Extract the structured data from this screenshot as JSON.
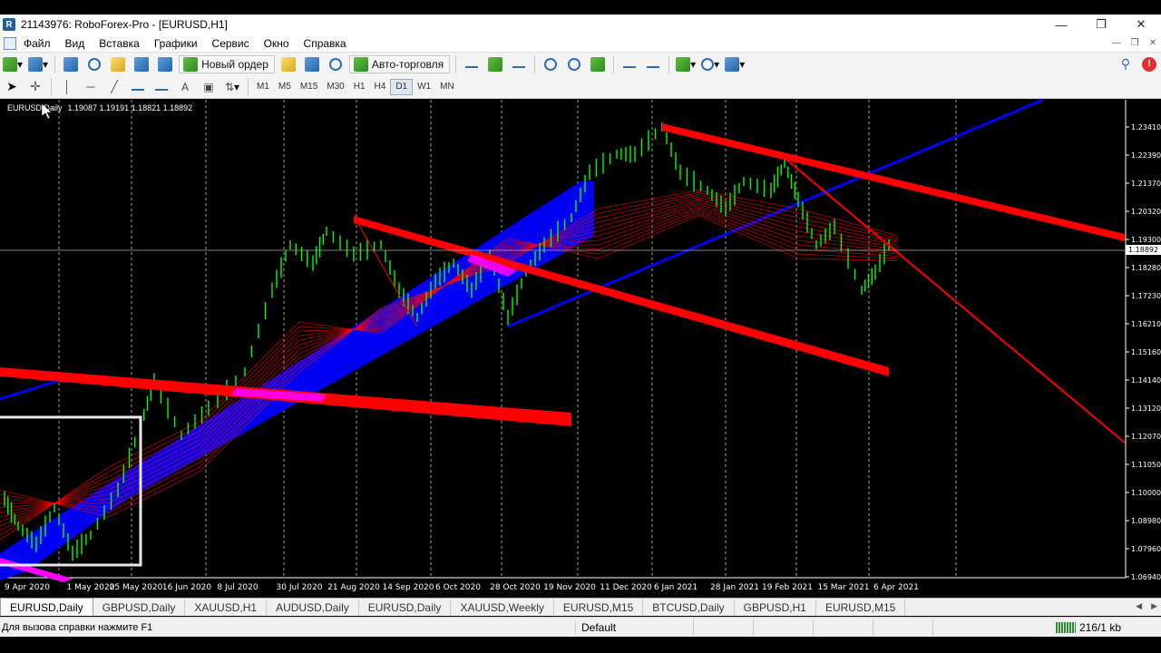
{
  "window": {
    "title": "21143976: RoboForex-Pro - [EURUSD,H1]",
    "app_icon_letter": "R"
  },
  "menu": [
    "Файл",
    "Вид",
    "Вставка",
    "Графики",
    "Сервис",
    "Окно",
    "Справка"
  ],
  "toolbar": {
    "new_order_label": "Новый ордер",
    "auto_trading_label": "Авто-торговля",
    "timeframes": [
      "M1",
      "M5",
      "M15",
      "M30",
      "H1",
      "H4",
      "D1",
      "W1",
      "MN"
    ],
    "active_timeframe": "D1"
  },
  "chart": {
    "symbol_label": "EURUSD,Daily",
    "ohlc": "1.19087 1.19191 1.18821 1.18892",
    "current_price": "1.18892",
    "price_labels": [
      "1.23410",
      "1.22390",
      "1.21370",
      "1.20320",
      "1.19300",
      "1.18280",
      "1.17230",
      "1.16210",
      "1.15160",
      "1.14140",
      "1.13120",
      "1.12070",
      "1.11050",
      "1.10000",
      "1.08980",
      "1.07960",
      "1.06940"
    ],
    "date_labels": [
      "9 Apr 2020",
      "1 May 2020",
      "25 May 2020",
      "16 Jun 2020",
      "8 Jul 2020",
      "30 Jul 2020",
      "21 Aug 2020",
      "14 Sep 2020",
      "6 Oct 2020",
      "28 Oct 2020",
      "19 Nov 2020",
      "11 Dec 2020",
      "6 Jan 2021",
      "28 Jan 2021",
      "19 Feb 2021",
      "15 Mar 2021",
      "6 Apr 2021"
    ],
    "colors": {
      "background": "#000000",
      "candles": "#00ff00",
      "trendlines": "#ff0000",
      "channel": "#0000ff",
      "highlight": "#ff00ff",
      "grid": "#cfcfcf"
    }
  },
  "tabs": [
    "EURUSD,Daily",
    "GBPUSD,Daily",
    "XAUUSD,H1",
    "AUDUSD,Daily",
    "EURUSD,Daily",
    "XAUUSD,Weekly",
    "EURUSD,M15",
    "BTCUSD,Daily",
    "GBPUSD,H1",
    "EURUSD,M15"
  ],
  "active_tab": 0,
  "status": {
    "help_text": "Для вызова справки нажмите F1",
    "profile": "Default",
    "connection": "216/1 kb"
  },
  "icons": {
    "window_controls": [
      "minimize-icon",
      "restore-icon",
      "close-icon"
    ],
    "notification_badge": "!"
  }
}
